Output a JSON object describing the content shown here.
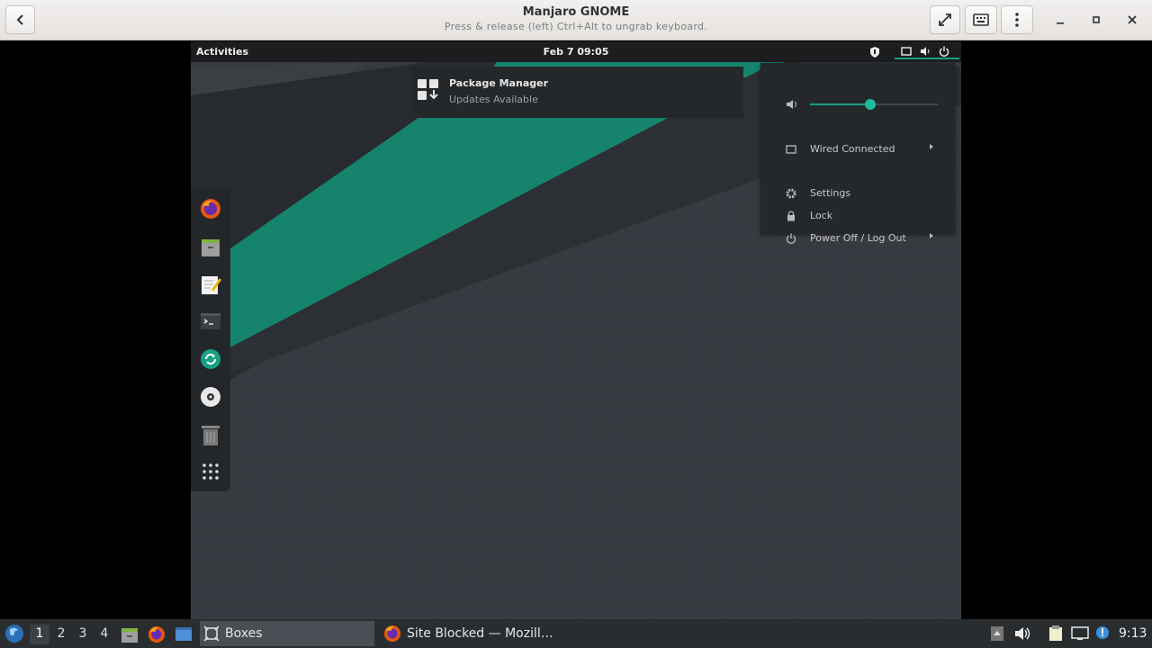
{
  "header": {
    "title": "Manjaro GNOME",
    "subtitle": "Press & release (left) Ctrl+Alt to ungrab keyboard.",
    "back_icon": "back-arrow-icon",
    "fullscreen_icon": "fullscreen-icon",
    "keyboard_icon": "keyboard-icon",
    "menu_icon": "kebab-menu-icon"
  },
  "guest": {
    "topbar": {
      "activities": "Activities",
      "clock": "Feb 7  09:05"
    },
    "notification": {
      "title": "Package Manager",
      "body": "Updates Available"
    },
    "system_menu": {
      "volume_level": 0.47,
      "wired": "Wired Connected",
      "settings": "Settings",
      "lock": "Lock",
      "power": "Power Off / Log Out"
    },
    "dock": [
      "firefox",
      "files",
      "text-editor",
      "terminal",
      "software-updater",
      "disc",
      "trash",
      "show-apps"
    ]
  },
  "taskbar": {
    "workspaces": [
      "1",
      "2",
      "3",
      "4"
    ],
    "active_workspace": "1",
    "tasks": [
      {
        "label": "Boxes",
        "active": true
      },
      {
        "label": "Site Blocked — Mozill…",
        "active": false
      }
    ],
    "clock": "9:13"
  },
  "colors": {
    "accent": "#16a085",
    "wallpaper_green": "#16836d"
  }
}
